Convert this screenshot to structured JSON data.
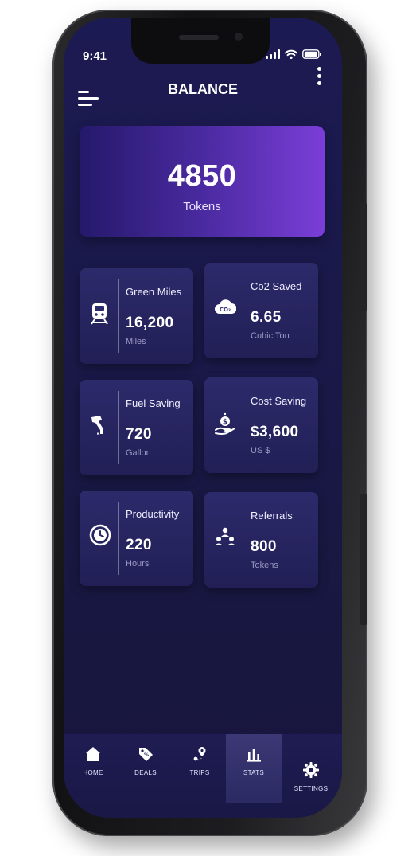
{
  "status_bar": {
    "time": "9:41"
  },
  "header": {
    "title": "BALANCE"
  },
  "balance": {
    "value": "4850",
    "unit": "Tokens"
  },
  "stats": [
    {
      "label": "Green Miles",
      "value": "16,200",
      "unit": "Miles",
      "icon": "train-icon"
    },
    {
      "label": "Co2 Saved",
      "value": "6.65",
      "unit": "Cubic Ton",
      "icon": "co2-cloud-icon"
    },
    {
      "label": "Fuel Saving",
      "value": "720",
      "unit": "Gallon",
      "icon": "fuel-nozzle-icon"
    },
    {
      "label": "Cost Saving",
      "value": "$3,600",
      "unit": "US $",
      "icon": "money-hand-icon"
    },
    {
      "label": "Productivity",
      "value": "220",
      "unit": "Hours",
      "icon": "clock-icon"
    },
    {
      "label": "Referrals",
      "value": "800",
      "unit": "Tokens",
      "icon": "people-network-icon"
    }
  ],
  "tabs": [
    {
      "label": "HOME",
      "icon": "home-icon",
      "active": false
    },
    {
      "label": "DEALS",
      "icon": "tag-icon",
      "active": false
    },
    {
      "label": "TRIPS",
      "icon": "map-pin-icon",
      "active": false
    },
    {
      "label": "STATS",
      "icon": "bar-chart-icon",
      "active": true
    },
    {
      "label": "SETTINGS",
      "icon": "gear-icon",
      "active": false
    }
  ],
  "colors": {
    "screen_bg": "#1c1a52",
    "card_gradient_start": "#24196a",
    "card_gradient_end": "#7a3ed8",
    "stat_card_bg": "#2d2a6b",
    "unit_text": "#9d9ac4"
  }
}
